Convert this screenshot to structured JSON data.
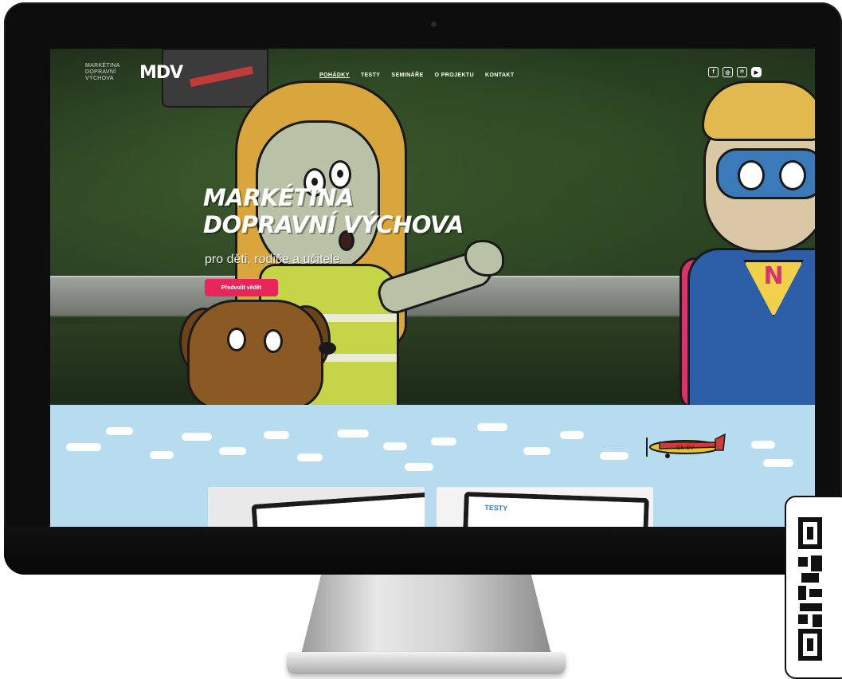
{
  "site": {
    "logo": {
      "text_lines": [
        "MARKÉTINA",
        "DOPRAVNÍ",
        "VÝCHOVA"
      ],
      "mark": "MDV"
    },
    "nav": {
      "items": [
        {
          "label": "POHÁDKY",
          "active": true
        },
        {
          "label": "TESTY",
          "active": false
        },
        {
          "label": "SEMINÁŘE",
          "active": false
        },
        {
          "label": "O PROJEKTU",
          "active": false
        },
        {
          "label": "KONTAKT",
          "active": false
        }
      ]
    },
    "social": {
      "icons": [
        "facebook-icon",
        "instagram-icon",
        "pinterest-icon",
        "youtube-icon"
      ],
      "glyphs": [
        "f",
        "◎",
        "℗",
        "▶"
      ]
    },
    "hero": {
      "title_line1": "MARKÉTINA",
      "title_line2": "DOPRAVNÍ VÝCHOVA",
      "subtitle": "pro děti, rodiče a učitele",
      "cta_label": "Předvolit vědět"
    },
    "illustration": {
      "plane_label": "OK-DV",
      "emblem_letter": "N"
    },
    "cards": {
      "card2_heading": "TESTY"
    }
  },
  "colors": {
    "accent": "#e8265b",
    "sky": "#b8dcef",
    "monitor": "#0d0d0d"
  }
}
